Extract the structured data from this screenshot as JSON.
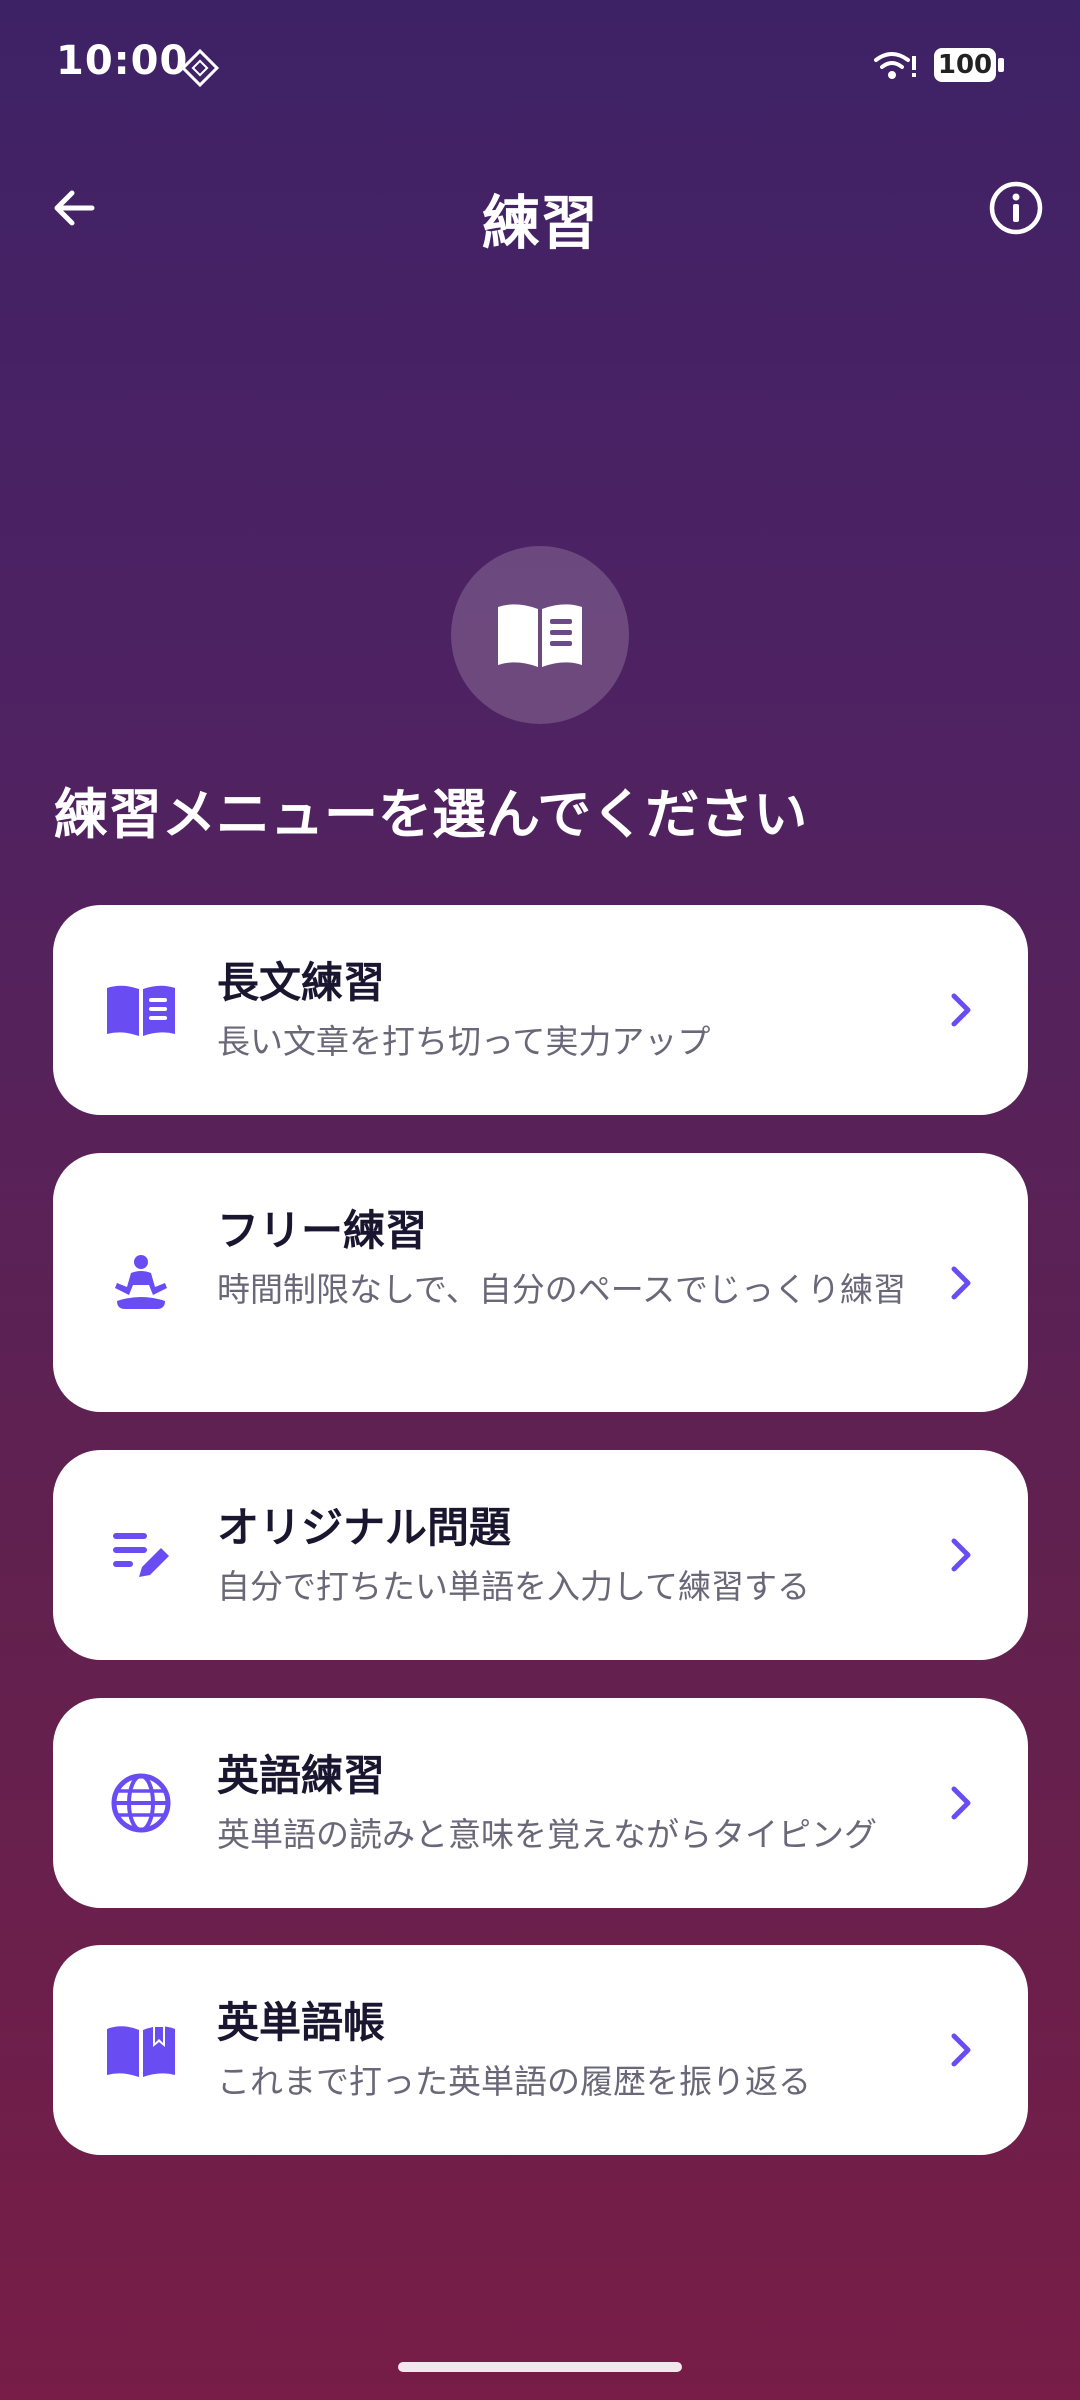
{
  "status_bar": {
    "time": "10:00",
    "battery": "100",
    "icons": [
      "settings-diamond-icon",
      "wifi-icon",
      "battery-icon"
    ]
  },
  "header": {
    "title": "練習",
    "back_icon": "arrow-left-icon",
    "info_icon": "info-icon"
  },
  "hero": {
    "icon": "open-book-icon"
  },
  "section_heading": "練習メニューを選んでください",
  "menu": [
    {
      "icon": "open-book-icon",
      "title": "長文練習",
      "description": "長い文章を打ち切って実力アップ"
    },
    {
      "icon": "meditation-icon",
      "title": "フリー練習",
      "description": "時間制限なしで、自分のペースでじっくり練習"
    },
    {
      "icon": "edit-list-icon",
      "title": "オリジナル問題",
      "description": "自分で打ちたい単語を入力して練習する"
    },
    {
      "icon": "globe-icon",
      "title": "英語練習",
      "description": "英単語の読みと意味を覚えながらタイピング"
    },
    {
      "icon": "book-bookmark-icon",
      "title": "英単語帳",
      "description": "これまで打った英単語の履歴を振り返る"
    }
  ],
  "colors": {
    "accent": "#6a4df2",
    "card_background": "#ffffff",
    "title_text": "#1b1630",
    "description_text": "#6a6878",
    "background_top": "#3e2266",
    "background_bottom": "#771d47"
  }
}
